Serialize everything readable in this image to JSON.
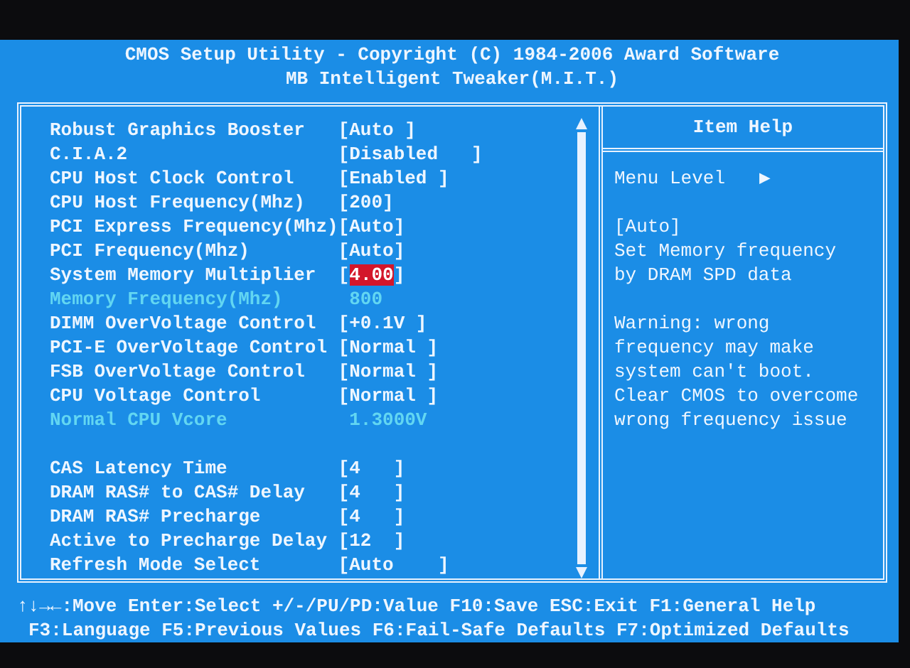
{
  "header": {
    "title": "CMOS Setup Utility - Copyright (C) 1984-2006 Award Software",
    "subtitle": "MB Intelligent Tweaker(M.I.T.)"
  },
  "settings": [
    {
      "label": "Robust Graphics Booster",
      "value": "[Auto ]",
      "selected": false,
      "disabled": false
    },
    {
      "label": "C.I.A.2",
      "value": "[Disabled   ]",
      "selected": false,
      "disabled": false
    },
    {
      "label": "CPU Host Clock Control",
      "value": "[Enabled ]",
      "selected": false,
      "disabled": false
    },
    {
      "label": "CPU Host Frequency(Mhz)",
      "value": "[200]",
      "selected": false,
      "disabled": false
    },
    {
      "label": "PCI Express Frequency(Mhz)",
      "value": "[Auto]",
      "selected": false,
      "disabled": false
    },
    {
      "label": "PCI Frequency(Mhz)",
      "value": "[Auto]",
      "selected": false,
      "disabled": false
    },
    {
      "label": "System Memory Multiplier",
      "value": "[4.00]",
      "selected": true,
      "disabled": false
    },
    {
      "label": "Memory Frequency(Mhz)",
      "value": "800",
      "selected": false,
      "disabled": true
    },
    {
      "label": "DIMM OverVoltage Control",
      "value": "[+0.1V ]",
      "selected": false,
      "disabled": false
    },
    {
      "label": "PCI-E OverVoltage Control",
      "value": "[Normal ]",
      "selected": false,
      "disabled": false
    },
    {
      "label": "FSB OverVoltage Control",
      "value": "[Normal ]",
      "selected": false,
      "disabled": false
    },
    {
      "label": "CPU Voltage Control",
      "value": "[Normal ]",
      "selected": false,
      "disabled": false
    },
    {
      "label": "Normal CPU Vcore",
      "value": "1.3000V",
      "selected": false,
      "disabled": true
    },
    {
      "label": "CAS Latency Time",
      "value": "[4   ]",
      "selected": false,
      "disabled": false,
      "gap_before": true
    },
    {
      "label": "DRAM RAS# to CAS# Delay",
      "value": "[4   ]",
      "selected": false,
      "disabled": false
    },
    {
      "label": "DRAM RAS# Precharge",
      "value": "[4   ]",
      "selected": false,
      "disabled": false
    },
    {
      "label": "Active to Precharge Delay",
      "value": "[12  ]",
      "selected": false,
      "disabled": false
    },
    {
      "label": "Refresh Mode Select",
      "value": "[Auto    ]",
      "selected": false,
      "disabled": false
    }
  ],
  "item_help": {
    "title": "Item Help",
    "menu_level": "Menu Level",
    "menu_level_marker": "▶",
    "paragraphs": [
      [
        "[Auto]",
        "Set Memory frequency",
        "by DRAM SPD data"
      ],
      [
        "Warning: wrong",
        "frequency may make",
        "system can't boot.",
        "Clear CMOS to overcome",
        "wrong frequency issue"
      ]
    ]
  },
  "key_hints": [
    [
      "↑↓→←:Move",
      "Enter:Select",
      "+/-/PU/PD:Value",
      "F10:Save",
      "ESC:Exit",
      "F1:General Help"
    ],
    [
      "F3:Language",
      "F5:Previous Values",
      "F6:Fail-Safe Defaults",
      "F7:Optimized Defaults"
    ]
  ]
}
